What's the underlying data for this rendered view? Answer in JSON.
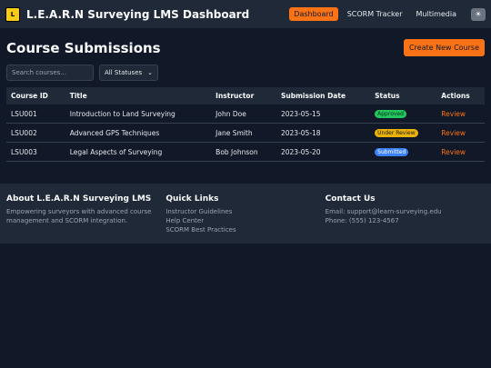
{
  "header": {
    "brand": "L.E.A.R.N Surveying LMS Dashboard",
    "nav": [
      "Dashboard",
      "SCORM Tracker",
      "Multimedia"
    ],
    "theme_icon": "☀"
  },
  "main": {
    "title": "Course Submissions",
    "create_label": "Create New Course",
    "search_placeholder": "Search courses...",
    "status_filter": "All Statuses"
  },
  "table": {
    "headers": [
      "Course ID",
      "Title",
      "Instructor",
      "Submission Date",
      "Status",
      "Actions"
    ],
    "rows": [
      {
        "id": "LSU001",
        "title": "Introduction to Land Surveying",
        "instructor": "John Doe",
        "date": "2023-05-15",
        "status": "Approved",
        "action": "Review"
      },
      {
        "id": "LSU002",
        "title": "Advanced GPS Techniques",
        "instructor": "Jane Smith",
        "date": "2023-05-18",
        "status": "Under Review",
        "action": "Review"
      },
      {
        "id": "LSU003",
        "title": "Legal Aspects of Surveying",
        "instructor": "Bob Johnson",
        "date": "2023-05-20",
        "status": "Submitted",
        "action": "Review"
      }
    ]
  },
  "footer": {
    "about_title": "About L.E.A.R.N Surveying LMS",
    "about_text": "Empowering surveyors with advanced course management and SCORM integration.",
    "links_title": "Quick Links",
    "links": [
      "Instructor Guidelines",
      "Help Center",
      "SCORM Best Practices"
    ],
    "contact_title": "Contact Us",
    "email": "Email: support@learn-surveying.edu",
    "phone": "Phone: (555) 123-4567"
  }
}
